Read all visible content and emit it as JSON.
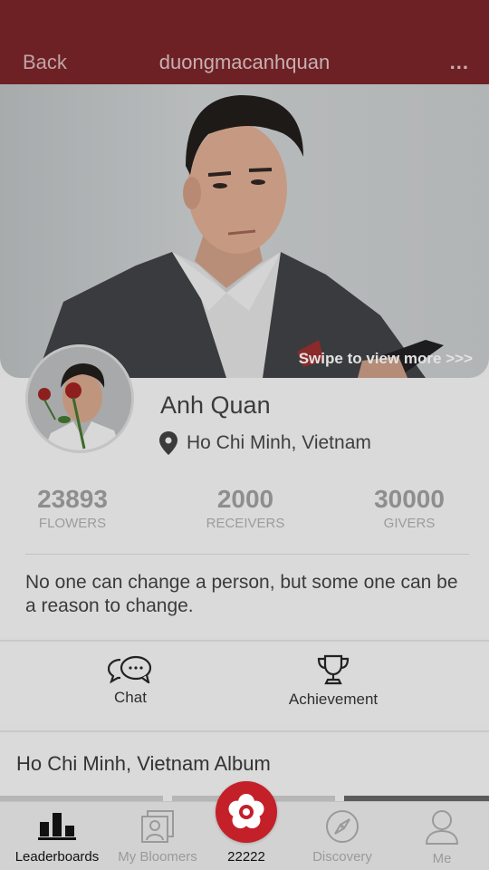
{
  "header": {
    "back_label": "Back",
    "title": "duongmacanhquan",
    "more_label": "..."
  },
  "cover": {
    "swipe_hint": "Swipe to view more >>>"
  },
  "profile": {
    "name": "Anh Quan",
    "location": "Ho Chi Minh, Vietnam",
    "stats": [
      {
        "value": "23893",
        "label": "FLOWERS"
      },
      {
        "value": "2000",
        "label": "RECEIVERS"
      },
      {
        "value": "30000",
        "label": "GIVERS"
      }
    ],
    "bio": "No one can change a person, but some one can be a reason to change."
  },
  "actions": {
    "chat_label": "Chat",
    "achievement_label": "Achievement"
  },
  "album": {
    "title": "Ho Chi Minh, Vietnam Album"
  },
  "tabbar": {
    "items": [
      {
        "label": "Leaderboards",
        "icon": "podium-icon"
      },
      {
        "label": "My Bloomers",
        "icon": "photo-frame-icon"
      },
      {
        "label": "22222",
        "icon": "flower-icon"
      },
      {
        "label": "Discovery",
        "icon": "compass-icon"
      },
      {
        "label": "Me",
        "icon": "person-icon"
      }
    ]
  },
  "colors": {
    "header_bg": "#6e2125",
    "accent_red": "#c4202a",
    "active_tab": "#111111",
    "inactive_tab": "#9a9a9a"
  }
}
